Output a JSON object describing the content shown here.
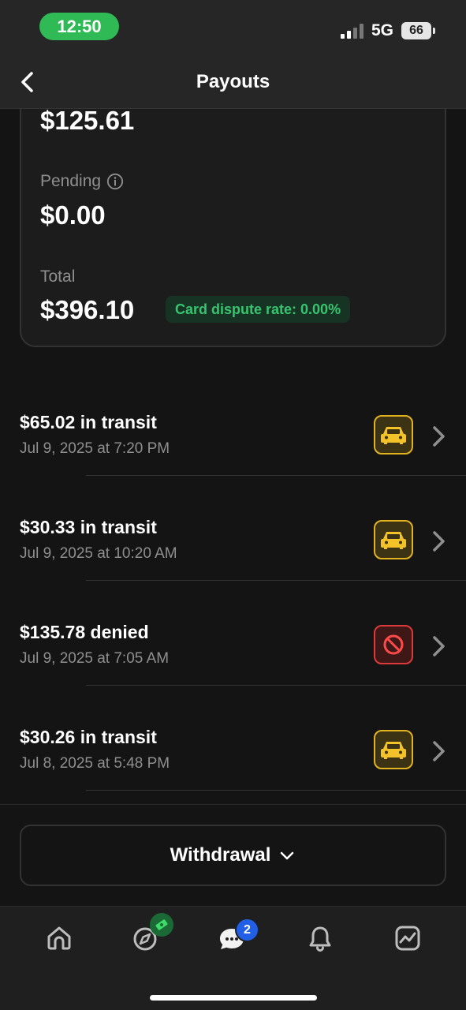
{
  "status_bar": {
    "time": "12:50",
    "network": "5G",
    "battery": "66"
  },
  "header": {
    "title": "Payouts"
  },
  "summary": {
    "available_amount": "$125.61",
    "pending_label": "Pending",
    "pending_amount": "$0.00",
    "total_label": "Total",
    "total_amount": "$396.10",
    "dispute_badge": "Card dispute rate: 0.00%"
  },
  "payouts": [
    {
      "title": "$65.02 in transit",
      "date": "Jul 9, 2025 at 7:20 PM",
      "status_icon": "car-icon"
    },
    {
      "title": "$30.33 in transit",
      "date": "Jul 9, 2025 at 10:20 AM",
      "status_icon": "car-icon"
    },
    {
      "title": "$135.78 denied",
      "date": "Jul 9, 2025 at 7:05 AM",
      "status_icon": "denied-icon"
    },
    {
      "title": "$30.26 in transit",
      "date": "Jul 8, 2025 at 5:48 PM",
      "status_icon": "car-icon"
    }
  ],
  "withdraw": {
    "label": "Withdrawal"
  },
  "tabbar": {
    "tabs": [
      "home-icon",
      "compass-icon",
      "chat-icon",
      "bell-icon",
      "chart-icon"
    ],
    "chat_badge_count": "2"
  },
  "colors": {
    "accent_green": "#37c46f",
    "transit_yellow": "#e2b21f",
    "denied_red": "#dc3a3a",
    "badge_blue": "#2160e6"
  }
}
